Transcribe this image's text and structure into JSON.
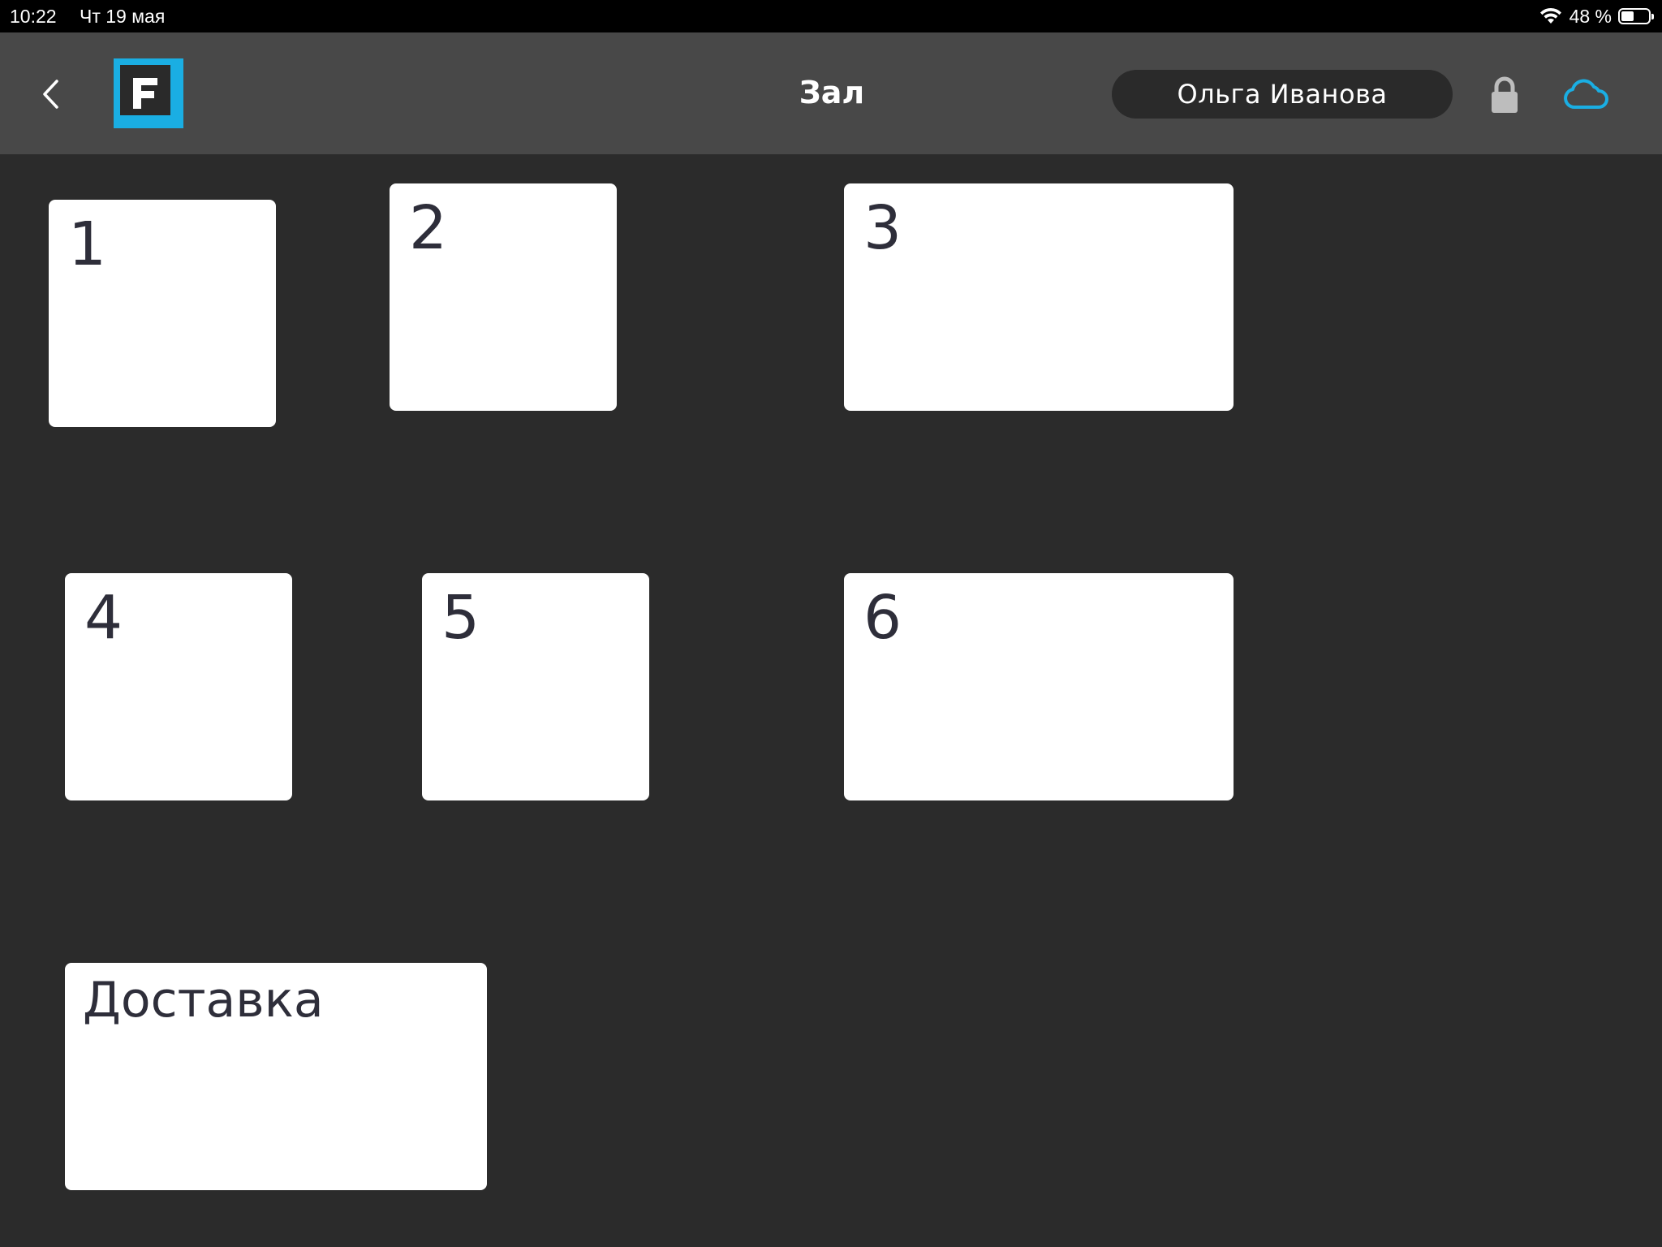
{
  "status_bar": {
    "time": "10:22",
    "date": "Чт 19 мая",
    "battery_percent": "48 %",
    "battery_level": 0.48
  },
  "nav": {
    "title": "Зал",
    "user_name": "Ольга Иванова",
    "accent_color": "#1aaee3",
    "icons": {
      "back": "chevron-left-icon",
      "logo": "app-logo-f",
      "lock": "lock-icon",
      "cloud": "cloud-icon"
    }
  },
  "tables": [
    {
      "label": "1"
    },
    {
      "label": "2"
    },
    {
      "label": "3"
    },
    {
      "label": "4"
    },
    {
      "label": "5"
    },
    {
      "label": "6"
    },
    {
      "label": "Доставка"
    }
  ]
}
